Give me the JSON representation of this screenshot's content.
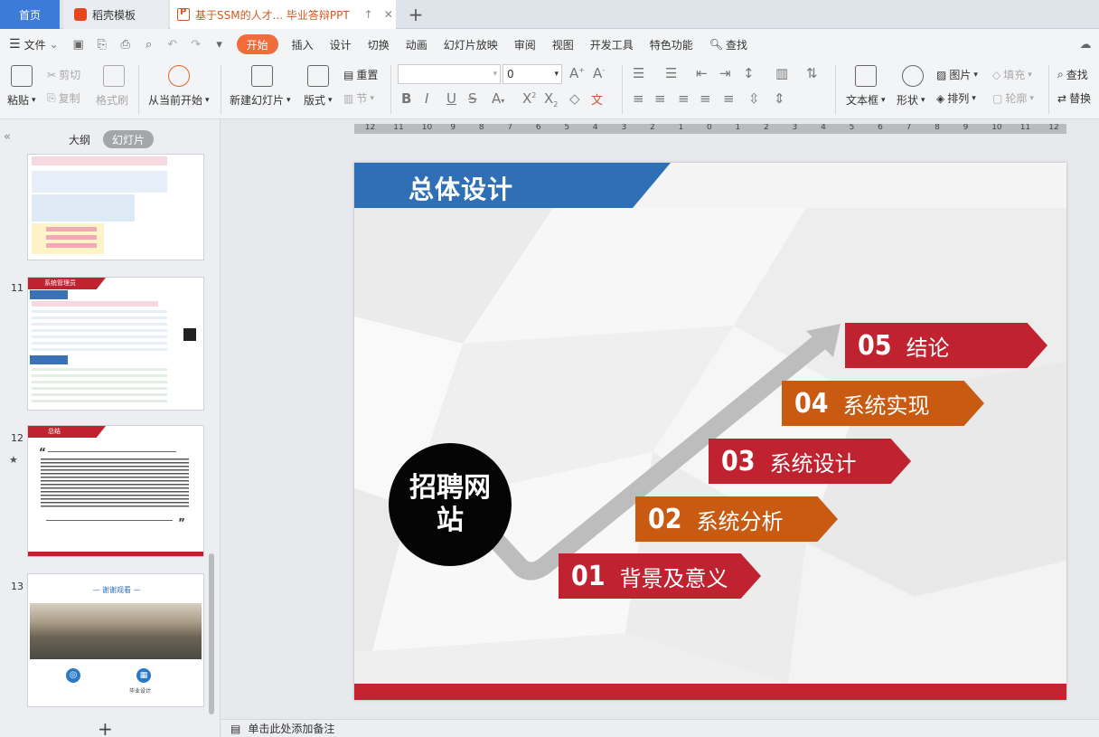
{
  "tabs": {
    "home": "首页",
    "template": "稻壳模板",
    "doc": "基于SSM的人才... 毕业答辩PPT",
    "add": "+"
  },
  "menu": {
    "file": "文件",
    "items": [
      "开始",
      "插入",
      "设计",
      "切换",
      "动画",
      "幻灯片放映",
      "审阅",
      "视图",
      "开发工具",
      "特色功能"
    ],
    "search": "查找"
  },
  "ribbon": {
    "paste": "粘贴",
    "cut": "剪切",
    "copy": "复制",
    "format_painter": "格式刷",
    "play_from_current": "从当前开始",
    "new_slide": "新建幻灯片",
    "layout": "版式",
    "reset": "重置",
    "section": "节",
    "font_size": "0",
    "textbox": "文本框",
    "shape": "形状",
    "picture": "图片",
    "arrange": "排列",
    "fill": "填充",
    "outline": "轮廓",
    "find": "查找",
    "replace": "替换"
  },
  "left_panel": {
    "tab_outline": "大纲",
    "tab_slides": "幻灯片",
    "slide_numbers": [
      "11",
      "12",
      "13"
    ],
    "thumb11_title": "系统管理员",
    "thumb12_title": "总结",
    "thumb13_title": "— 谢谢观看 —",
    "thumb13_caption": "毕业设计",
    "add_slide": "+"
  },
  "ruler_labels": [
    "12",
    "11",
    "10",
    "9",
    "8",
    "7",
    "6",
    "5",
    "4",
    "3",
    "2",
    "1",
    "0",
    "1",
    "2",
    "3",
    "4",
    "5",
    "6",
    "7",
    "8",
    "9",
    "10",
    "11",
    "12"
  ],
  "slide": {
    "title": "总体设计",
    "center_text": "招聘网站",
    "steps": [
      {
        "num": "01",
        "label": "背景及意义",
        "color": "#c0222f"
      },
      {
        "num": "02",
        "label": "系统分析",
        "color": "#c95a12"
      },
      {
        "num": "03",
        "label": "系统设计",
        "color": "#c0222f"
      },
      {
        "num": "04",
        "label": "系统实现",
        "color": "#c95a12"
      },
      {
        "num": "05",
        "label": "结论",
        "color": "#c0222f"
      }
    ],
    "colors": {
      "title_blue": "#2f6fb5",
      "red": "#c0222f",
      "orange": "#c95a12",
      "arrow_gray": "#bdbdbd"
    }
  },
  "status": {
    "notes_placeholder": "单击此处添加备注"
  }
}
